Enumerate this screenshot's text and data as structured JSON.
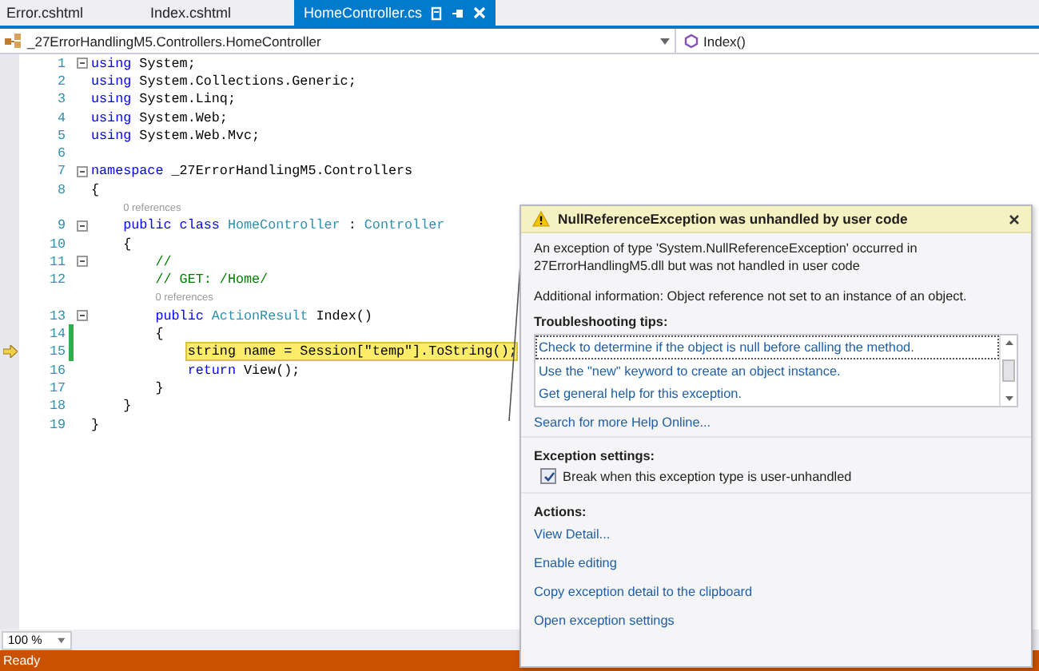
{
  "tabs": [
    {
      "label": "Error.cshtml",
      "selected": false
    },
    {
      "label": "Index.cshtml",
      "selected": false
    },
    {
      "label": "HomeController.cs",
      "selected": true
    }
  ],
  "navigation": {
    "type_dropdown": "_27ErrorHandlingM5.Controllers.HomeController",
    "member_dropdown": "Index()"
  },
  "code_rows": [
    {
      "kind": "line",
      "number": "1",
      "fold": true,
      "changed": false,
      "current": false,
      "tokens": [
        {
          "kind": "keyword",
          "text": "using"
        },
        {
          "kind": "plain",
          "text": " System;"
        }
      ]
    },
    {
      "kind": "line",
      "number": "2",
      "fold": false,
      "changed": false,
      "current": false,
      "tokens": [
        {
          "kind": "keyword",
          "text": "using"
        },
        {
          "kind": "plain",
          "text": " System.Collections.Generic;"
        }
      ]
    },
    {
      "kind": "line",
      "number": "3",
      "fold": false,
      "changed": false,
      "current": false,
      "tokens": [
        {
          "kind": "keyword",
          "text": "using"
        },
        {
          "kind": "plain",
          "text": " System.Linq;"
        }
      ]
    },
    {
      "kind": "line",
      "number": "4",
      "fold": false,
      "changed": false,
      "current": false,
      "tokens": [
        {
          "kind": "keyword",
          "text": "using"
        },
        {
          "kind": "plain",
          "text": " System.Web;"
        }
      ]
    },
    {
      "kind": "line",
      "number": "5",
      "fold": false,
      "changed": false,
      "current": false,
      "tokens": [
        {
          "kind": "keyword",
          "text": "using"
        },
        {
          "kind": "plain",
          "text": " System.Web.Mvc;"
        }
      ]
    },
    {
      "kind": "line",
      "number": "6",
      "fold": false,
      "changed": false,
      "current": false,
      "tokens": []
    },
    {
      "kind": "line",
      "number": "7",
      "fold": true,
      "changed": false,
      "current": false,
      "tokens": [
        {
          "kind": "keyword",
          "text": "namespace"
        },
        {
          "kind": "plain",
          "text": " _27ErrorHandlingM5.Controllers"
        }
      ]
    },
    {
      "kind": "line",
      "number": "8",
      "fold": false,
      "changed": false,
      "current": false,
      "tokens": [
        {
          "kind": "plain",
          "text": "{"
        }
      ]
    },
    {
      "kind": "codelens",
      "text": "0 references"
    },
    {
      "kind": "line",
      "number": "9",
      "fold": true,
      "changed": false,
      "current": false,
      "tokens": [
        {
          "kind": "keyword",
          "text": "    public class "
        },
        {
          "kind": "type",
          "text": "HomeController"
        },
        {
          "kind": "plain",
          "text": " : "
        },
        {
          "kind": "type",
          "text": "Controller"
        }
      ]
    },
    {
      "kind": "line",
      "number": "10",
      "fold": false,
      "changed": false,
      "current": false,
      "tokens": [
        {
          "kind": "plain",
          "text": "    {"
        }
      ]
    },
    {
      "kind": "line",
      "number": "11",
      "fold": true,
      "changed": false,
      "current": false,
      "tokens": [
        {
          "kind": "comment",
          "text": "        //"
        }
      ]
    },
    {
      "kind": "line",
      "number": "12",
      "fold": false,
      "changed": false,
      "current": false,
      "tokens": [
        {
          "kind": "comment",
          "text": "        // GET: /Home/"
        }
      ]
    },
    {
      "kind": "codelens",
      "text": "0 references"
    },
    {
      "kind": "line",
      "number": "13",
      "fold": true,
      "changed": false,
      "current": false,
      "tokens": [
        {
          "kind": "keyword",
          "text": "        public "
        },
        {
          "kind": "type",
          "text": "ActionResult"
        },
        {
          "kind": "plain",
          "text": " Index()"
        }
      ]
    },
    {
      "kind": "line",
      "number": "14",
      "fold": false,
      "changed": true,
      "current": false,
      "tokens": [
        {
          "kind": "plain",
          "text": "        {"
        }
      ]
    },
    {
      "kind": "line",
      "number": "15",
      "fold": false,
      "changed": true,
      "current": true,
      "tokens": [
        {
          "kind": "highlight",
          "text": "            string name = Session[\"temp\"].ToString();"
        }
      ]
    },
    {
      "kind": "line",
      "number": "16",
      "fold": false,
      "changed": false,
      "current": false,
      "tokens": [
        {
          "kind": "keyword",
          "text": "            return"
        },
        {
          "kind": "plain",
          "text": " View();"
        }
      ]
    },
    {
      "kind": "line",
      "number": "17",
      "fold": false,
      "changed": false,
      "current": false,
      "tokens": [
        {
          "kind": "plain",
          "text": "        }"
        }
      ]
    },
    {
      "kind": "line",
      "number": "18",
      "fold": false,
      "changed": false,
      "current": false,
      "tokens": [
        {
          "kind": "plain",
          "text": "    }"
        }
      ]
    },
    {
      "kind": "line",
      "number": "19",
      "fold": false,
      "changed": false,
      "current": false,
      "tokens": [
        {
          "kind": "plain",
          "text": "}"
        }
      ]
    }
  ],
  "zoom": "100 %",
  "status_bar": "Ready",
  "exception_popup": {
    "title": "NullReferenceException was unhandled by user code",
    "message": "An exception of type 'System.NullReferenceException' occurred in 27ErrorHandlingM5.dll but was not handled in user code",
    "additional_info": "Additional information: Object reference not set to an instance of an object.",
    "tips_heading": "Troubleshooting tips:",
    "tips": [
      {
        "text": "Check to determine if the object is null before calling the method.",
        "selected": true
      },
      {
        "text": "Use the \"new\" keyword to create an object instance.",
        "selected": false
      },
      {
        "text": "Get general help for this exception.",
        "selected": false
      }
    ],
    "search_link": "Search for more Help Online...",
    "settings_heading": "Exception settings:",
    "break_option": {
      "label": "Break when this exception type is user-unhandled",
      "checked": true
    },
    "actions_heading": "Actions:",
    "actions": [
      "View Detail...",
      "Enable editing",
      "Copy exception detail to the clipboard",
      "Open exception settings"
    ]
  }
}
